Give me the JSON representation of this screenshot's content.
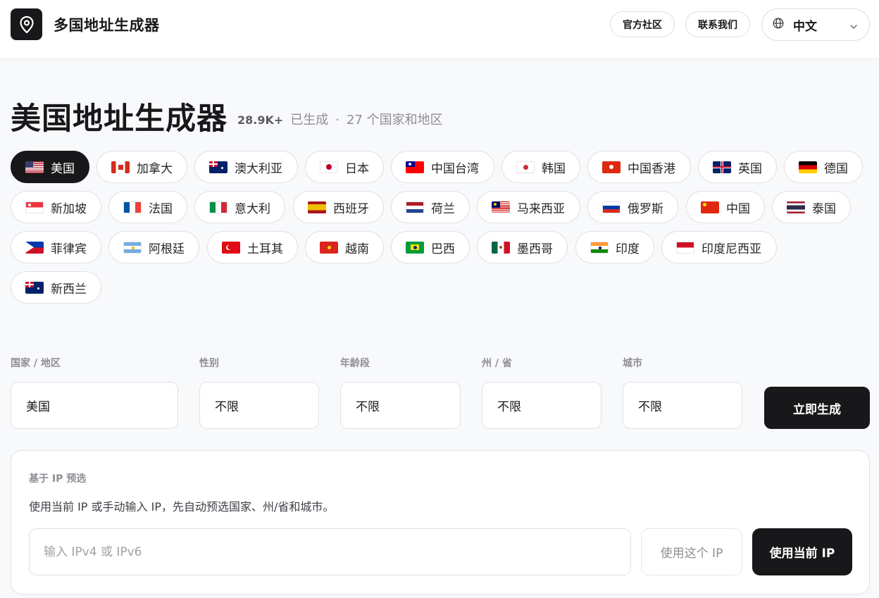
{
  "header": {
    "app_title": "多国地址生成器",
    "community_label": "官方社区",
    "contact_label": "联系我们",
    "language_label": "中文"
  },
  "main": {
    "page_title": "美国地址生成器",
    "generated_count": "28.9K+",
    "generated_label": "已生成",
    "separator": "·",
    "coverage_text": "27 个国家和地区"
  },
  "countries": [
    {
      "label": "美国",
      "flag": "us",
      "active": true
    },
    {
      "label": "加拿大",
      "flag": "ca"
    },
    {
      "label": "澳大利亚",
      "flag": "au"
    },
    {
      "label": "日本",
      "flag": "jp"
    },
    {
      "label": "中国台湾",
      "flag": "tw"
    },
    {
      "label": "韩国",
      "flag": "kr"
    },
    {
      "label": "中国香港",
      "flag": "hk"
    },
    {
      "label": "英国",
      "flag": "gb"
    },
    {
      "label": "德国",
      "flag": "de"
    },
    {
      "label": "新加坡",
      "flag": "sg"
    },
    {
      "label": "法国",
      "flag": "fr"
    },
    {
      "label": "意大利",
      "flag": "it"
    },
    {
      "label": "西班牙",
      "flag": "es"
    },
    {
      "label": "荷兰",
      "flag": "nl"
    },
    {
      "label": "马来西亚",
      "flag": "my"
    },
    {
      "label": "俄罗斯",
      "flag": "ru"
    },
    {
      "label": "中国",
      "flag": "cn"
    },
    {
      "label": "泰国",
      "flag": "th"
    },
    {
      "label": "菲律宾",
      "flag": "ph"
    },
    {
      "label": "阿根廷",
      "flag": "ar"
    },
    {
      "label": "土耳其",
      "flag": "tr"
    },
    {
      "label": "越南",
      "flag": "vn"
    },
    {
      "label": "巴西",
      "flag": "br"
    },
    {
      "label": "墨西哥",
      "flag": "mx"
    },
    {
      "label": "印度",
      "flag": "in"
    },
    {
      "label": "印度尼西亚",
      "flag": "id"
    },
    {
      "label": "新西兰",
      "flag": "nz"
    }
  ],
  "form": {
    "country_label": "国家 / 地区",
    "country_value": "美国",
    "gender_label": "性别",
    "gender_value": "不限",
    "age_label": "年龄段",
    "age_value": "不限",
    "state_label": "州 / 省",
    "state_value": "不限",
    "city_label": "城市",
    "city_value": "不限",
    "generate_label": "立即生成"
  },
  "ip_panel": {
    "title": "基于 IP 预选",
    "description": "使用当前 IP 或手动输入 IP，先自动预选国家、州/省和城市。",
    "input_placeholder": "输入 IPv4 或 IPv6",
    "input_value": "",
    "use_this_ip_label": "使用这个 IP",
    "use_current_ip_label": "使用当前 IP"
  },
  "colors": {
    "primary": "#18181b",
    "background": "#f8f9fb",
    "muted_text": "#8e8e95",
    "border": "#e1e1e5"
  }
}
